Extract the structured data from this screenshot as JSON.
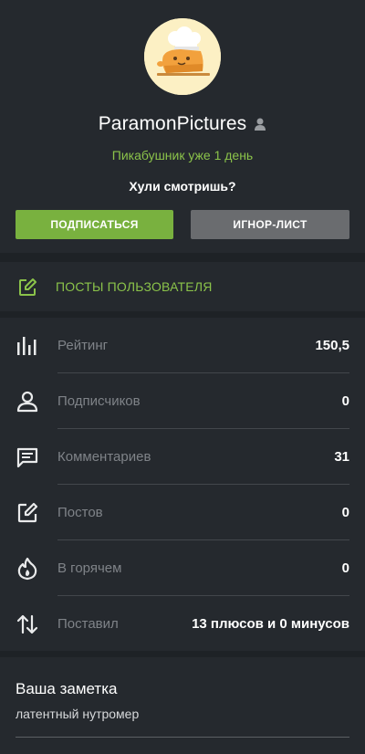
{
  "profile": {
    "username": "ParamonPictures",
    "since": "Пикабушник уже 1 день",
    "status": "Хули смотришь?",
    "subscribe_label": "ПОДПИСАТЬСЯ",
    "ignore_label": "ИГНОР-ЛИСТ",
    "avatar_icon": "chef-bun-avatar",
    "gender_icon": "user-icon"
  },
  "posts_link": {
    "label": "ПОСТЫ ПОЛЬЗОВАТЕЛЯ",
    "icon": "edit-icon"
  },
  "stats": [
    {
      "icon": "rating-icon",
      "label": "Рейтинг",
      "value": "150,5"
    },
    {
      "icon": "subscribers-icon",
      "label": "Подписчиков",
      "value": "0"
    },
    {
      "icon": "comments-icon",
      "label": "Комментариев",
      "value": "31"
    },
    {
      "icon": "posts-icon",
      "label": "Постов",
      "value": "0"
    },
    {
      "icon": "hot-icon",
      "label": "В горячем",
      "value": "0"
    },
    {
      "icon": "votes-icon",
      "label": "Поставил",
      "value": "13 плюсов и 0 минусов"
    }
  ],
  "note": {
    "title": "Ваша заметка",
    "text": "латентный нутромер"
  },
  "colors": {
    "accent_green": "#8bc34a",
    "button_green": "#79b13f",
    "button_gray": "#6a6c6f",
    "background": "#1e2226",
    "panel": "#25292e"
  }
}
